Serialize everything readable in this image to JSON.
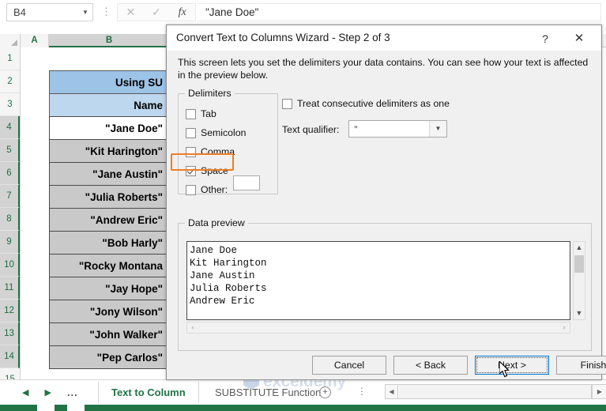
{
  "formula_bar": {
    "name_box_value": "B4",
    "name_box_arrow": "▼",
    "more_dots": "⋮",
    "cancel_icon": "✕",
    "confirm_icon": "✓",
    "fx_label": "fx",
    "formula_value": "\"Jane Doe\""
  },
  "grid": {
    "column_headers": [
      "A",
      "B"
    ],
    "row_headers": [
      "1",
      "2",
      "3",
      "4",
      "5",
      "6",
      "7",
      "8",
      "9",
      "10",
      "11",
      "12",
      "13",
      "14",
      "15"
    ],
    "cells": {
      "b2": "Using SU",
      "b3": "Name",
      "b4": "\"Jane Doe\"",
      "b5": "\"Kit Harington\"",
      "b6": "\"Jane Austin\"",
      "b7": "\"Julia Roberts\"",
      "b8": "\"Andrew Eric\"",
      "b9": "\"Bob Harly\"",
      "b10": "\"Rocky Montana",
      "b11": "\"Jay Hope\"",
      "b12": "\"Jony Wilson\"",
      "b13": "\"John Walker\"",
      "b14": "\"Pep Carlos\""
    },
    "header_fill_1": "#9DC3E6",
    "header_fill_2": "#BDD7EE",
    "data_fill": "#C9C9C9"
  },
  "tab_bar": {
    "nav_first": "◀",
    "nav_last": "▶",
    "nav_dots": "...",
    "tabs": [
      {
        "label": "Text to Column",
        "active": true
      },
      {
        "label": "SUBSTITUTE Function",
        "active": false
      }
    ],
    "add_sheet": "+",
    "more_icon": "⋮",
    "hscroll_left": "◀",
    "hscroll_right": "▶"
  },
  "watermark": {
    "text": "exceldemy"
  },
  "dialog": {
    "title": "Convert Text to Columns Wizard - Step 2 of 3",
    "help_icon": "?",
    "close_icon": "✕",
    "description": "This screen lets you set the delimiters your data contains.  You can see how your text is affected in the preview below.",
    "delimiters": {
      "group_label": "Delimiters",
      "items": [
        {
          "label": "Tab",
          "checked": false
        },
        {
          "label": "Semicolon",
          "checked": false
        },
        {
          "label": "Comma",
          "checked": false
        },
        {
          "label": "Space",
          "checked": true
        },
        {
          "label": "Other:",
          "checked": false
        }
      ],
      "other_value": "",
      "highlight_color": "#EF7D22"
    },
    "treat_consecutive": {
      "label": "Treat consecutive delimiters as one",
      "checked": false
    },
    "text_qualifier": {
      "label": "Text qualifier:",
      "value": "\"",
      "arrow": "▼"
    },
    "data_preview": {
      "group_label": "Data preview",
      "lines": [
        "Jane Doe",
        "Kit Harington",
        "Jane Austin",
        "Julia Roberts",
        "Andrew Eric"
      ],
      "scroll_up": "▲",
      "scroll_down": "▼",
      "scroll_left": "‹",
      "scroll_right": "›"
    },
    "buttons": {
      "cancel": "Cancel",
      "back": "< Back",
      "next": "Next >",
      "finish": "Finish"
    }
  }
}
